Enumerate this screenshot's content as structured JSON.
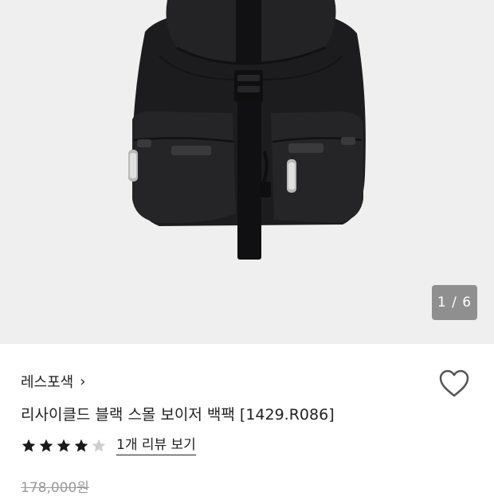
{
  "gallery": {
    "counter": "1 / 6",
    "current_index": 1,
    "total": 6
  },
  "product": {
    "brand": "레스포색",
    "brand_chevron": "›",
    "title": "리사이클드 블랙 스몰 보이저 백팩 [1429.R086]",
    "rating": 4,
    "rating_max": 5,
    "review_link": "1개 리뷰 보기",
    "original_price": "178,000원"
  },
  "icons": {
    "favorite": "heart-outline-icon",
    "brand_link": "chevron-right-icon",
    "rating": "star-icon"
  },
  "colors": {
    "star_filled": "#1a1a1a",
    "star_empty": "#cfcfcf",
    "gallery_bg": "#efefef",
    "counter_bg": "#8f8f8f"
  }
}
